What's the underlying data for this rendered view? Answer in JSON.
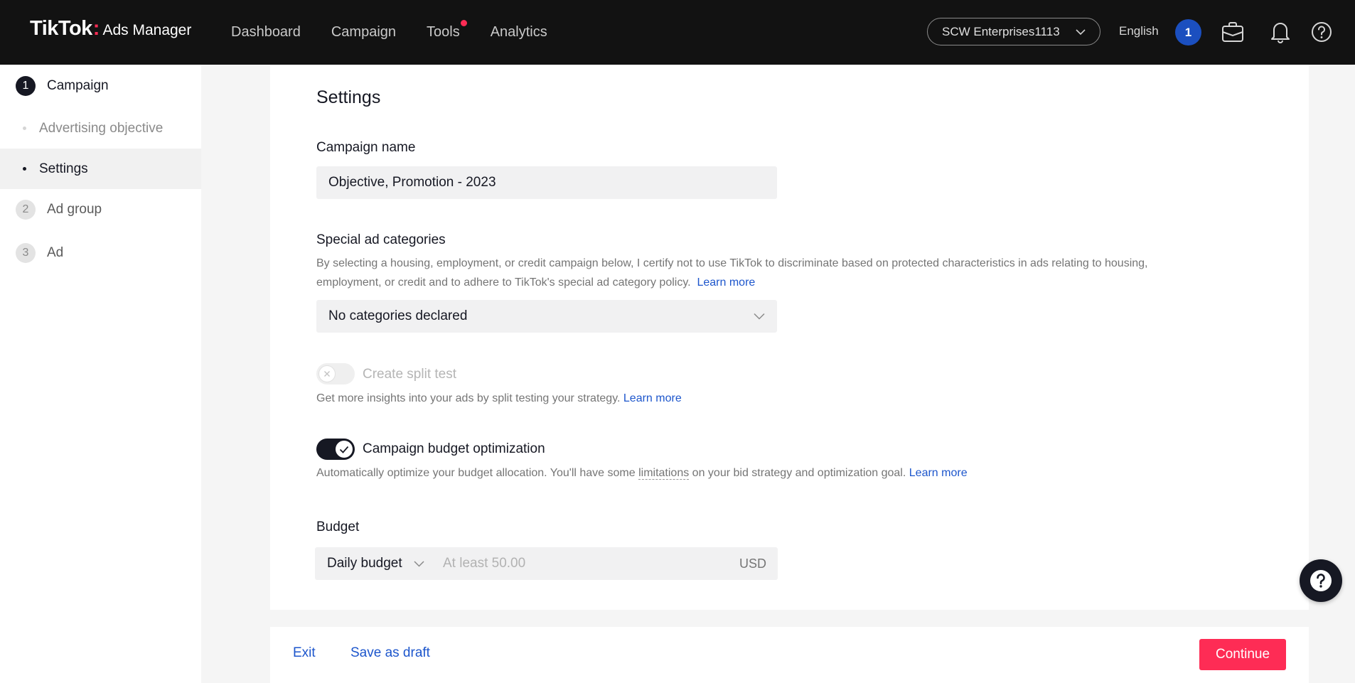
{
  "header": {
    "brand_name": "TikTok",
    "brand_colon": ":",
    "brand_product": "Ads Manager",
    "nav": [
      "Dashboard",
      "Campaign",
      "Tools",
      "Analytics"
    ],
    "account": "SCW Enterprises1113",
    "language": "English",
    "avatar_initial": "1",
    "icons": [
      "briefcase-icon",
      "bell-icon",
      "help-circle-icon"
    ]
  },
  "sidebar": {
    "steps": [
      {
        "number": "1",
        "label": "Campaign",
        "state": "active"
      },
      {
        "number": "2",
        "label": "Ad group",
        "state": "inactive"
      },
      {
        "number": "3",
        "label": "Ad",
        "state": "inactive"
      }
    ],
    "substeps": [
      {
        "label": "Advertising objective",
        "selected": false
      },
      {
        "label": "Settings",
        "selected": true
      }
    ]
  },
  "settings": {
    "title": "Settings",
    "campaign_name": {
      "label": "Campaign name",
      "value": "Objective, Promotion - 2023"
    },
    "special_ad_categories": {
      "label": "Special ad categories",
      "description": "By selecting a housing, employment, or credit campaign below, I certify not to use TikTok to discriminate based on protected characteristics in ads relating to housing, employment, or credit and to adhere to TikTok's special ad category policy.",
      "learn_more": "Learn more",
      "selected": "No categories declared"
    },
    "split_test": {
      "label": "Create split test",
      "enabled": false,
      "description": "Get more insights into your ads by split testing your strategy.",
      "learn_more": "Learn more"
    },
    "cbo": {
      "label": "Campaign budget optimization",
      "enabled": true,
      "description_before": "Automatically optimize your budget allocation. You'll have some ",
      "limitations": "limitations",
      "description_after": " on your bid strategy and optimization goal.",
      "learn_more": "Learn more"
    },
    "budget": {
      "label": "Budget",
      "type": "Daily budget",
      "placeholder": "At least 50.00",
      "currency": "USD"
    }
  },
  "footer": {
    "exit": "Exit",
    "save_draft": "Save as draft",
    "continue": "Continue"
  },
  "colors": {
    "header_bg": "#121212",
    "brand_accent": "#fe2c55",
    "link": "#1d56cc",
    "primary_button": "#fe2c55"
  }
}
